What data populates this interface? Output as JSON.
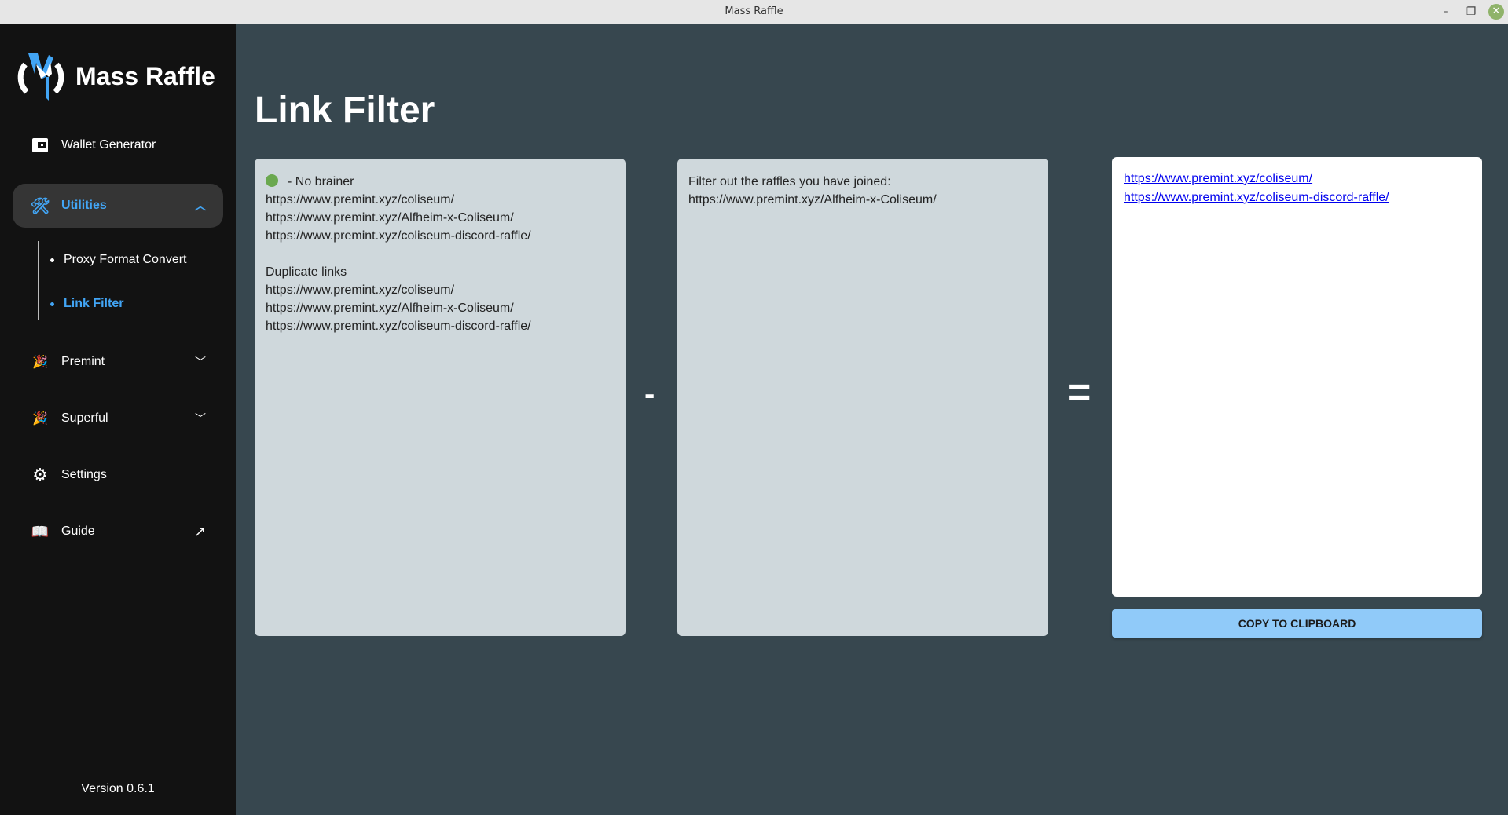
{
  "window": {
    "title": "Mass Raffle"
  },
  "sidebar": {
    "app_name": "Mass Raffle",
    "items": [
      {
        "label": "Wallet Generator"
      },
      {
        "label": "Utilities"
      },
      {
        "label": "Premint"
      },
      {
        "label": "Superful"
      },
      {
        "label": "Settings"
      },
      {
        "label": "Guide"
      }
    ],
    "sub_items": [
      {
        "label": "Proxy Format Convert"
      },
      {
        "label": "Link Filter"
      }
    ],
    "version": "Version 0.6.1"
  },
  "main": {
    "title": "Link Filter",
    "input_lines": [
      "- No brainer",
      "https://www.premint.xyz/coliseum/",
      "https://www.premint.xyz/Alfheim-x-Coliseum/",
      "https://www.premint.xyz/coliseum-discord-raffle/",
      "",
      "Duplicate links",
      "https://www.premint.xyz/coliseum/",
      "https://www.premint.xyz/Alfheim-x-Coliseum/",
      "https://www.premint.xyz/coliseum-discord-raffle/"
    ],
    "filter_lines": [
      "Filter out the raffles you have joined:",
      "https://www.premint.xyz/Alfheim-x-Coliseum/"
    ],
    "minus": "-",
    "equals": "=",
    "results": [
      "https://www.premint.xyz/coliseum/",
      "https://www.premint.xyz/coliseum-discord-raffle/"
    ],
    "copy_label": "COPY TO CLIPBOARD"
  },
  "colors": {
    "accent": "#42a5f5",
    "button": "#90caf9",
    "bg": "#37474f",
    "sidebar": "#121212"
  }
}
